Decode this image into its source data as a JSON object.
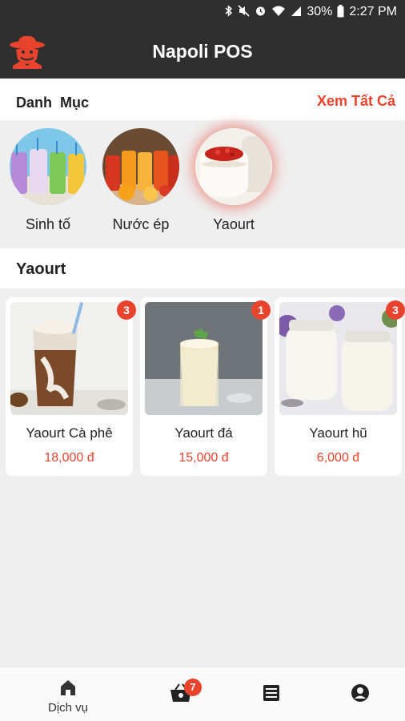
{
  "status_bar": {
    "battery": "30%",
    "time": "2:27 PM",
    "icons": [
      "bluetooth-icon",
      "mute-icon",
      "alarm-icon",
      "wifi-icon",
      "signal-icon",
      "battery-icon"
    ]
  },
  "app_bar": {
    "title": "Napoli POS",
    "logo": "cowboy-logo"
  },
  "categories": {
    "heading": "Danh  Mục",
    "see_all": "Xem Tất Cả",
    "items": [
      {
        "label": "Sinh tố",
        "active": false
      },
      {
        "label": "Nước ép",
        "active": false
      },
      {
        "label": "Yaourt",
        "active": true
      }
    ]
  },
  "section": {
    "title": "Yaourt"
  },
  "products": [
    {
      "name": "Yaourt Cà phê",
      "price": "18,000 đ",
      "count": "3"
    },
    {
      "name": "Yaourt đá",
      "price": "15,000 đ",
      "count": "1"
    },
    {
      "name": "Yaourt hũ",
      "price": "6,000 đ",
      "count": "3"
    }
  ],
  "bottom_nav": {
    "home_label": "Dịch vụ",
    "cart_count": "7",
    "icons": [
      "home-icon",
      "basket-icon",
      "list-icon",
      "account-icon"
    ]
  },
  "colors": {
    "accent": "#e8432c",
    "bar": "#2f2f2f",
    "background": "#efefef"
  }
}
